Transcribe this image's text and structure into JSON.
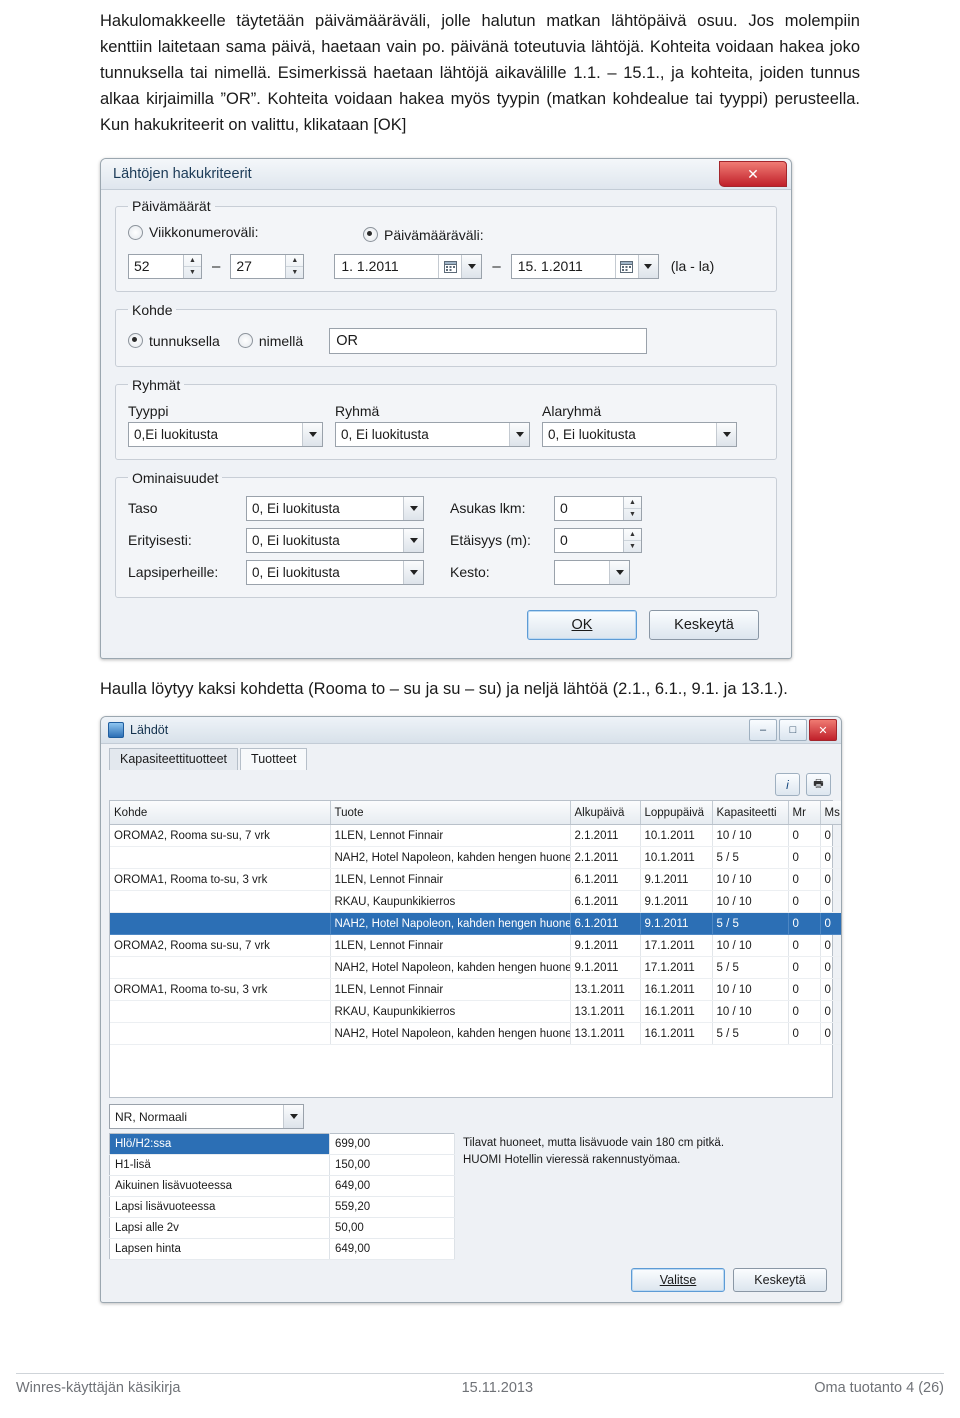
{
  "document": {
    "paragraph1": "Hakulomakkeelle täytetään päivämääräväli, jolle halutun matkan lähtöpäivä osuu. Jos molempiin kenttiin laitetaan sama päivä, haetaan vain po. päivänä toteutuvia lähtöjä. Kohteita voidaan hakea joko tunnuksella tai nimellä. Esimerkissä haetaan lähtöjä aikavälille 1.1. – 15.1., ja kohteita, joiden tunnus alkaa kirjaimilla ”OR”. Kohteita voidaan hakea myös tyypin (matkan kohdealue tai tyyppi) perusteella. Kun hakukriteerit on valittu, klikataan [OK]",
    "caption": "Haulla löytyy kaksi kohdetta (Rooma to – su ja su – su) ja neljä lähtöä (2.1., 6.1., 9.1. ja 13.1.)."
  },
  "dialog": {
    "title": "Lähtöjen hakukriteerit",
    "close_label": "✕",
    "dates_group": {
      "legend": "Päivämäärät",
      "week_radio": "Viikkonumeroväli:",
      "week_from": "52",
      "week_to": "27",
      "date_radio": "Päivämääräväli:",
      "date_from": "1. 1.2011",
      "date_to": "15. 1.2011",
      "hint": "(la - la)",
      "separator": "–"
    },
    "target_group": {
      "legend": "Kohde",
      "by_code": "tunnuksella",
      "by_name": "nimellä",
      "value": "OR"
    },
    "groups_group": {
      "legend": "Ryhmät",
      "fields": [
        {
          "label": "Tyyppi",
          "value": "0,Ei luokitusta"
        },
        {
          "label": "Ryhmä",
          "value": "0, Ei luokitusta"
        },
        {
          "label": "Alaryhmä",
          "value": "0, Ei luokitusta"
        }
      ]
    },
    "properties_group": {
      "legend": "Ominaisuudet",
      "left": [
        {
          "label": "Taso",
          "value": "0, Ei luokitusta"
        },
        {
          "label": "Erityisesti:",
          "value": "0, Ei luokitusta"
        },
        {
          "label": "Lapsiperheille:",
          "value": "0, Ei luokitusta"
        }
      ],
      "right": [
        {
          "label": "Asukas lkm:",
          "value": "0"
        },
        {
          "label": "Etäisyys (m):",
          "value": "0"
        },
        {
          "label": "Kesto:",
          "value": ""
        }
      ]
    },
    "ok_button": "OK",
    "cancel_button": "Keskeytä"
  },
  "window2": {
    "title": "Lähdöt",
    "min_label": "–",
    "max_label": "□",
    "close_label": "✕",
    "tabs": [
      {
        "label": "Kapasiteettituotteet",
        "active": false
      },
      {
        "label": "Tuotteet",
        "active": true
      }
    ],
    "toolbar": [
      {
        "name": "info-icon",
        "glyph": "i"
      },
      {
        "name": "print-icon",
        "glyph": "🖶"
      }
    ],
    "grid": {
      "columns": [
        "Kohde",
        "Tuote",
        "Alkupäivä",
        "Loppupäivä",
        "Kapasiteetti",
        "Mr",
        "Ms"
      ],
      "rows": [
        {
          "cells": [
            "OROMA2, Rooma su-su, 7 vrk",
            "1LEN, Lennot Finnair",
            "2.1.2011",
            "10.1.2011",
            "10 / 10",
            "0",
            "0"
          ],
          "selected": false
        },
        {
          "cells": [
            "",
            "NAH2, Hotel Napoleon, kahden hengen huone",
            "2.1.2011",
            "10.1.2011",
            "5 / 5",
            "0",
            "0"
          ],
          "selected": false
        },
        {
          "cells": [
            "OROMA1, Rooma to-su, 3 vrk",
            "1LEN, Lennot Finnair",
            "6.1.2011",
            "9.1.2011",
            "10 / 10",
            "0",
            "0"
          ],
          "selected": false
        },
        {
          "cells": [
            "",
            "RKAU, Kaupunkikierros",
            "6.1.2011",
            "9.1.2011",
            "10 / 10",
            "0",
            "0"
          ],
          "selected": false
        },
        {
          "cells": [
            "",
            "NAH2, Hotel Napoleon, kahden hengen huone",
            "6.1.2011",
            "9.1.2011",
            "5 / 5",
            "0",
            "0"
          ],
          "selected": true
        },
        {
          "cells": [
            "OROMA2, Rooma su-su, 7 vrk",
            "1LEN, Lennot Finnair",
            "9.1.2011",
            "17.1.2011",
            "10 / 10",
            "0",
            "0"
          ],
          "selected": false
        },
        {
          "cells": [
            "",
            "NAH2, Hotel Napoleon, kahden hengen huone",
            "9.1.2011",
            "17.1.2011",
            "5 / 5",
            "0",
            "0"
          ],
          "selected": false
        },
        {
          "cells": [
            "OROMA1, Rooma to-su, 3 vrk",
            "1LEN, Lennot Finnair",
            "13.1.2011",
            "16.1.2011",
            "10 / 10",
            "0",
            "0"
          ],
          "selected": false
        },
        {
          "cells": [
            "",
            "RKAU, Kaupunkikierros",
            "13.1.2011",
            "16.1.2011",
            "10 / 10",
            "0",
            "0"
          ],
          "selected": false
        },
        {
          "cells": [
            "",
            "NAH2, Hotel Napoleon, kahden hengen huone",
            "13.1.2011",
            "16.1.2011",
            "5 / 5",
            "0",
            "0"
          ],
          "selected": false
        }
      ]
    },
    "price_selector": "NR, Normaali",
    "prices": [
      {
        "label": "Hlö/H2:ssa",
        "amount": "699,00",
        "highlight": true
      },
      {
        "label": "H1-lisä",
        "amount": "150,00",
        "highlight": false
      },
      {
        "label": "Aikuinen lisävuoteessa",
        "amount": "649,00",
        "highlight": false
      },
      {
        "label": "Lapsi lisävuoteessa",
        "amount": "559,20",
        "highlight": false
      },
      {
        "label": "Lapsi alle 2v",
        "amount": "50,00",
        "highlight": false
      },
      {
        "label": "Lapsen hinta",
        "amount": "649,00",
        "highlight": false
      }
    ],
    "info_line1": "Tilavat huoneet, mutta lisävuode vain 180 cm pitkä.",
    "info_line2": "HUOMI Hotellin vieressä rakennustyömaa.",
    "select_button": "Valitse",
    "cancel_button": "Keskeytä"
  },
  "footer": {
    "left": "Winres-käyttäjän käsikirja",
    "center": "15.11.2013",
    "right": "Oma tuotanto 4 (26)"
  }
}
